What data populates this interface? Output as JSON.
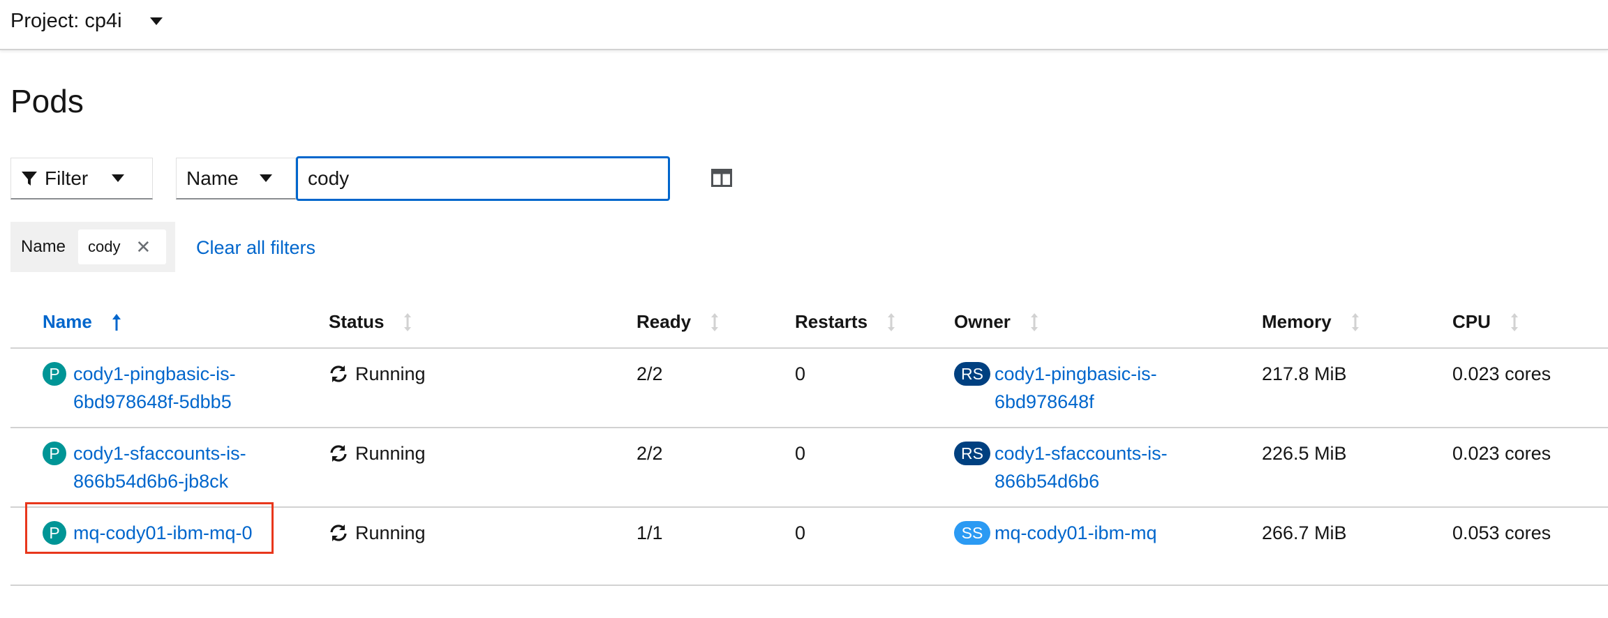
{
  "project": {
    "label": "Project: cp4i"
  },
  "page": {
    "title": "Pods"
  },
  "toolbar": {
    "filter_label": "Filter",
    "attribute_label": "Name",
    "search_value": "cody",
    "columns_icon": "columns-icon"
  },
  "active_filters": {
    "category": "Name",
    "chips": [
      "cody"
    ],
    "clear_all_label": "Clear all filters"
  },
  "table": {
    "columns": [
      "Name",
      "Status",
      "Ready",
      "Restarts",
      "Owner",
      "Memory",
      "CPU"
    ],
    "sorted_column": "Name",
    "rows": [
      {
        "badge": "P",
        "name": "cody1-pingbasic-is-6bd978648f-5dbb5",
        "status": "Running",
        "ready": "2/2",
        "restarts": "0",
        "owner_badge": "RS",
        "owner": "cody1-pingbasic-is-6bd978648f",
        "memory": "217.8 MiB",
        "cpu": "0.023 cores"
      },
      {
        "badge": "P",
        "name": "cody1-sfaccounts-is-866b54d6b6-jb8ck",
        "status": "Running",
        "ready": "2/2",
        "restarts": "0",
        "owner_badge": "RS",
        "owner": "cody1-sfaccounts-is-866b54d6b6",
        "memory": "226.5 MiB",
        "cpu": "0.023 cores"
      },
      {
        "badge": "P",
        "name": "mq-cody01-ibm-mq-0",
        "status": "Running",
        "ready": "1/1",
        "restarts": "0",
        "owner_badge": "SS",
        "owner": "mq-cody01-ibm-mq",
        "memory": "266.7 MiB",
        "cpu": "0.053 cores"
      }
    ]
  },
  "colors": {
    "link": "#0066cc",
    "pod_badge": "#009596",
    "replicaset_badge": "#004080",
    "statefulset_badge": "#2b9af3",
    "highlight": "#e8371c"
  }
}
